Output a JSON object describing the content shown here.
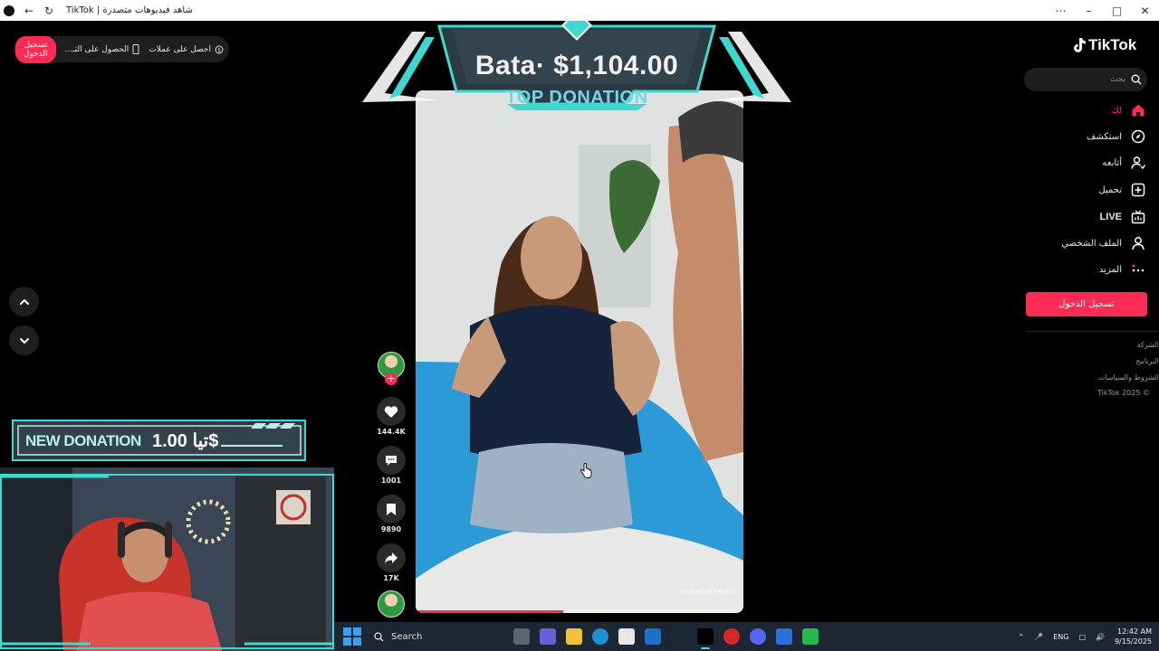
{
  "window": {
    "title": "TikTok | شاهد فيديوهات متصدرة",
    "controls": [
      "minimize-icon",
      "maximize-icon",
      "close-icon"
    ]
  },
  "top_pill": {
    "coins": "احصل على عملات",
    "get_app": "الحصول على التـ...",
    "login": "تسجيل الدخول"
  },
  "banner": {
    "amount": "Bata· $1,104.00",
    "caption": "TOP DONATION"
  },
  "video": {
    "watermark": "rehabalmalt",
    "progress": 0.45
  },
  "actions": {
    "likes": "144.4K",
    "comments": "1001",
    "saves": "9890",
    "shares": "17K"
  },
  "sidebar": {
    "logo": "TikTok",
    "search_placeholder": "بحث",
    "items": [
      {
        "label": "لك",
        "icon": "home-icon",
        "active": true
      },
      {
        "label": "استكشف",
        "icon": "compass-icon",
        "active": false
      },
      {
        "label": "أتابعه",
        "icon": "following-icon",
        "active": false
      },
      {
        "label": "تحميل",
        "icon": "upload-icon",
        "active": false
      },
      {
        "label": "LIVE",
        "icon": "live-icon",
        "active": false
      },
      {
        "label": "الملف الشخصي",
        "icon": "profile-icon",
        "active": false
      },
      {
        "label": "المزيد",
        "icon": "more-icon",
        "active": false
      }
    ],
    "login_button": "تسجيل الدخول",
    "footer": [
      "الشركة",
      "البرنامج",
      "الشروط والسياسات",
      "TikTok 2025 ©"
    ]
  },
  "new_donation": {
    "label": "NEW DONATION",
    "amount": "تيا 1.00$"
  },
  "taskbar": {
    "search": "Search",
    "language": "ENG",
    "time": "12:42 AM",
    "date": "9/15/2025"
  },
  "colors": {
    "accent": "#fe2c55",
    "banner_cyan": "#3fd8d0",
    "taskbar_bg": "#1c2733"
  }
}
